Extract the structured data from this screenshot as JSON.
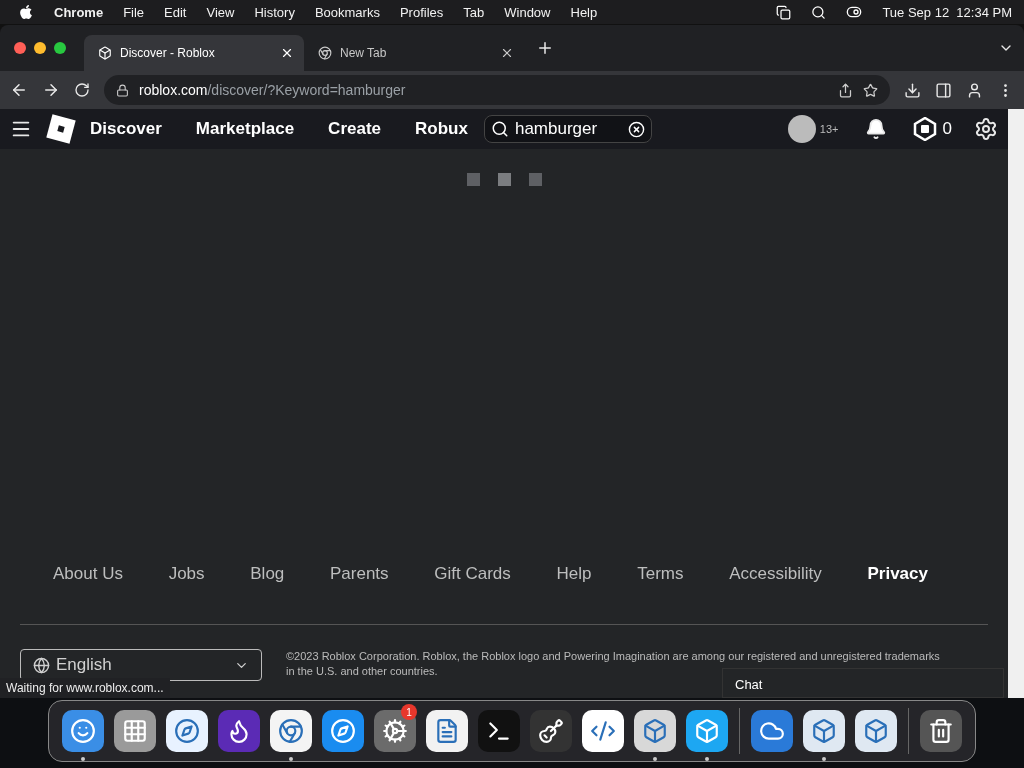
{
  "menubar": {
    "app": "Chrome",
    "items": [
      "File",
      "Edit",
      "View",
      "History",
      "Bookmarks",
      "Profiles",
      "Tab",
      "Window",
      "Help"
    ],
    "clock": "Tue Sep 12  12:34 PM"
  },
  "tabs": [
    {
      "title": "Discover - Roblox",
      "selected": true
    },
    {
      "title": "New Tab",
      "selected": false
    }
  ],
  "address": {
    "host": "roblox.com",
    "path": "/discover/?Keyword=hamburger"
  },
  "nav": {
    "links": [
      "Discover",
      "Marketplace",
      "Create",
      "Robux"
    ],
    "search": "hamburger",
    "age": "13+",
    "robux": "0"
  },
  "footer": {
    "links": [
      {
        "label": "About Us",
        "emphasized": false
      },
      {
        "label": "Jobs",
        "emphasized": false
      },
      {
        "label": "Blog",
        "emphasized": false
      },
      {
        "label": "Parents",
        "emphasized": false
      },
      {
        "label": "Gift Cards",
        "emphasized": false
      },
      {
        "label": "Help",
        "emphasized": false
      },
      {
        "label": "Terms",
        "emphasized": false
      },
      {
        "label": "Accessibility",
        "emphasized": false
      },
      {
        "label": "Privacy",
        "emphasized": true
      }
    ],
    "language": "English",
    "copyright": "©2023 Roblox Corporation. Roblox, the Roblox logo and Powering Imagination are among our registered and unregistered trademarks in the U.S. and other countries."
  },
  "status": "Waiting for www.roblox.com...",
  "chat": "Chat",
  "dock": {
    "groups": [
      [
        {
          "running": true
        },
        {
          "running": false
        },
        {
          "running": false
        },
        {
          "running": false
        },
        {
          "running": true
        },
        {
          "running": false
        },
        {
          "running": false,
          "badge": "1"
        },
        {
          "running": false
        },
        {
          "running": false
        },
        {
          "running": false
        },
        {
          "running": false
        },
        {
          "running": true
        },
        {
          "running": true
        }
      ],
      [
        {
          "running": false
        },
        {
          "running": true
        },
        {
          "running": false
        }
      ],
      [
        {
          "running": false
        }
      ]
    ]
  }
}
